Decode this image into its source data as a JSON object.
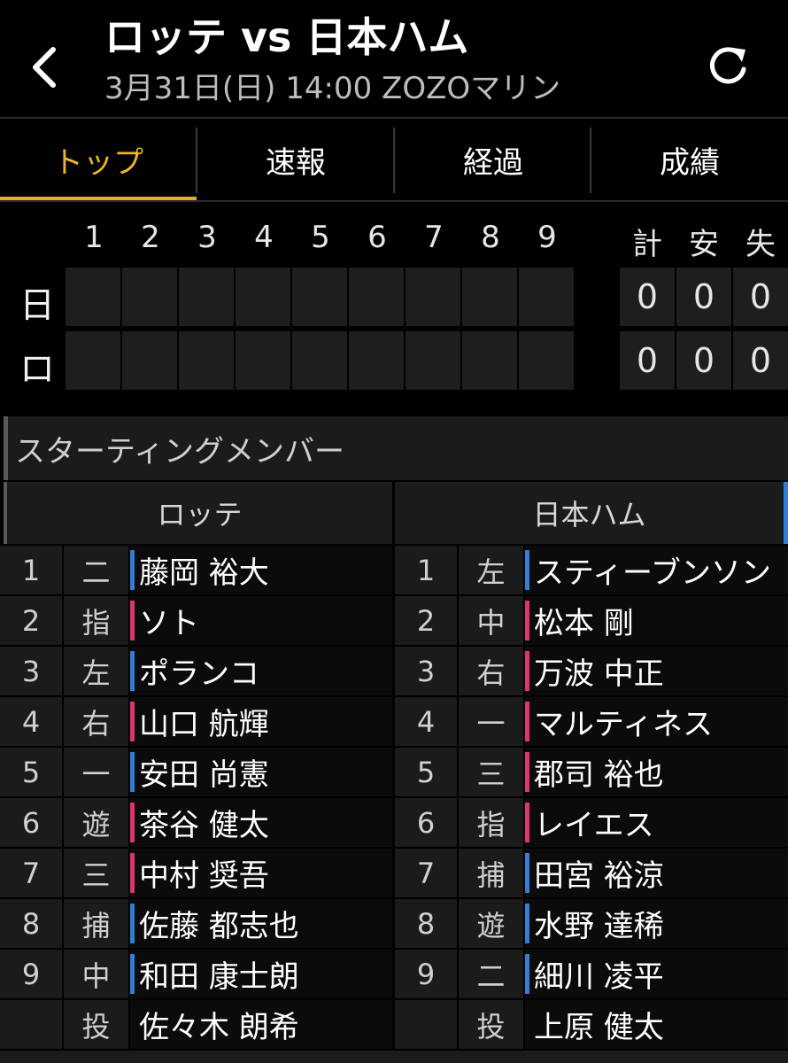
{
  "header": {
    "title": "ロッテ vs 日本ハム",
    "subtitle": "3月31日(日) 14:00 ZOZOマリン",
    "back_icon": "chevron-left-icon",
    "refresh_icon": "refresh-icon"
  },
  "tabs": [
    {
      "label": "トップ",
      "active": true
    },
    {
      "label": "速報",
      "active": false
    },
    {
      "label": "経過",
      "active": false
    },
    {
      "label": "成績",
      "active": false
    }
  ],
  "scoreboard": {
    "innings": [
      "1",
      "2",
      "3",
      "4",
      "5",
      "6",
      "7",
      "8",
      "9"
    ],
    "totals_headers": [
      "計",
      "安",
      "失"
    ],
    "teams": [
      {
        "abbr": "日",
        "runs": "0",
        "hits": "0",
        "errors": "0"
      },
      {
        "abbr": "ロ",
        "runs": "0",
        "hits": "0",
        "errors": "0"
      }
    ]
  },
  "lineup": {
    "section_title": "スターティングメンバー",
    "home_team": "ロッテ",
    "away_team": "日本ハム",
    "home": [
      {
        "order": "1",
        "pos": "二",
        "name": "藤岡 裕大",
        "bat": "L"
      },
      {
        "order": "2",
        "pos": "指",
        "name": "ソト",
        "bat": "R"
      },
      {
        "order": "3",
        "pos": "左",
        "name": "ポランコ",
        "bat": "L"
      },
      {
        "order": "4",
        "pos": "右",
        "name": "山口 航輝",
        "bat": "R"
      },
      {
        "order": "5",
        "pos": "一",
        "name": "安田 尚憲",
        "bat": "L"
      },
      {
        "order": "6",
        "pos": "遊",
        "name": "茶谷 健太",
        "bat": "R"
      },
      {
        "order": "7",
        "pos": "三",
        "name": "中村 奨吾",
        "bat": "R"
      },
      {
        "order": "8",
        "pos": "捕",
        "name": "佐藤 都志也",
        "bat": "L"
      },
      {
        "order": "9",
        "pos": "中",
        "name": "和田 康士朗",
        "bat": "L"
      },
      {
        "order": "",
        "pos": "投",
        "name": "佐々木 朗希",
        "bat": ""
      }
    ],
    "away": [
      {
        "order": "1",
        "pos": "左",
        "name": "スティーブンソン",
        "bat": "L"
      },
      {
        "order": "2",
        "pos": "中",
        "name": "松本 剛",
        "bat": "R"
      },
      {
        "order": "3",
        "pos": "右",
        "name": "万波 中正",
        "bat": "R"
      },
      {
        "order": "4",
        "pos": "一",
        "name": "マルティネス",
        "bat": "R"
      },
      {
        "order": "5",
        "pos": "三",
        "name": "郡司 裕也",
        "bat": "R"
      },
      {
        "order": "6",
        "pos": "指",
        "name": "レイエス",
        "bat": "R"
      },
      {
        "order": "7",
        "pos": "捕",
        "name": "田宮 裕涼",
        "bat": "L"
      },
      {
        "order": "8",
        "pos": "遊",
        "name": "水野 達稀",
        "bat": "L"
      },
      {
        "order": "9",
        "pos": "二",
        "name": "細川 凌平",
        "bat": "L"
      },
      {
        "order": "",
        "pos": "投",
        "name": "上原 健太",
        "bat": ""
      }
    ]
  },
  "colors": {
    "accent": "#e3a93b",
    "left_bat": "#2f7fd6",
    "right_bat": "#e0336e"
  }
}
